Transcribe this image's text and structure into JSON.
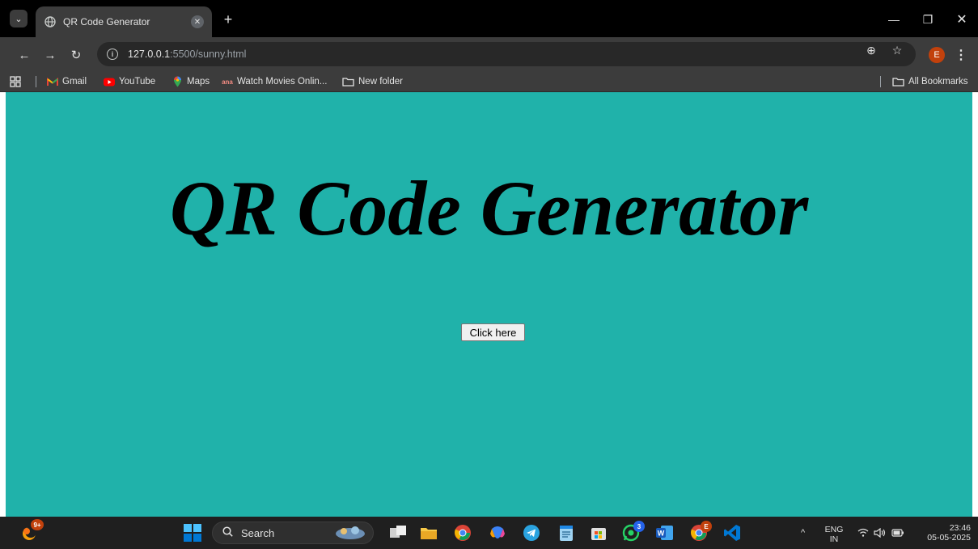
{
  "browser": {
    "tab_title": "QR Code Generator",
    "url_host": "127.0.0.1",
    "url_path": ":5500/sunny.html",
    "profile_initial": "E"
  },
  "bookmarks": {
    "items": [
      {
        "label": "Gmail",
        "icon": "gmail-icon"
      },
      {
        "label": "YouTube",
        "icon": "youtube-icon"
      },
      {
        "label": "Maps",
        "icon": "maps-icon"
      },
      {
        "label": "Watch Movies Onlin...",
        "icon": "site-favicon"
      },
      {
        "label": "New folder",
        "icon": "folder-icon"
      }
    ],
    "all_bookmarks": "All Bookmarks",
    "site_favicon_text": "ana"
  },
  "page": {
    "heading": "QR Code Generator",
    "button_label": "Click here",
    "background_color": "#20b2aa"
  },
  "taskbar": {
    "search_placeholder": "Search",
    "widget_badge": "9+",
    "whatsapp_badge": "3",
    "chrome_badge": "E",
    "language_top": "ENG",
    "language_bottom": "IN",
    "time": "23:46",
    "date": "05-05-2025"
  }
}
